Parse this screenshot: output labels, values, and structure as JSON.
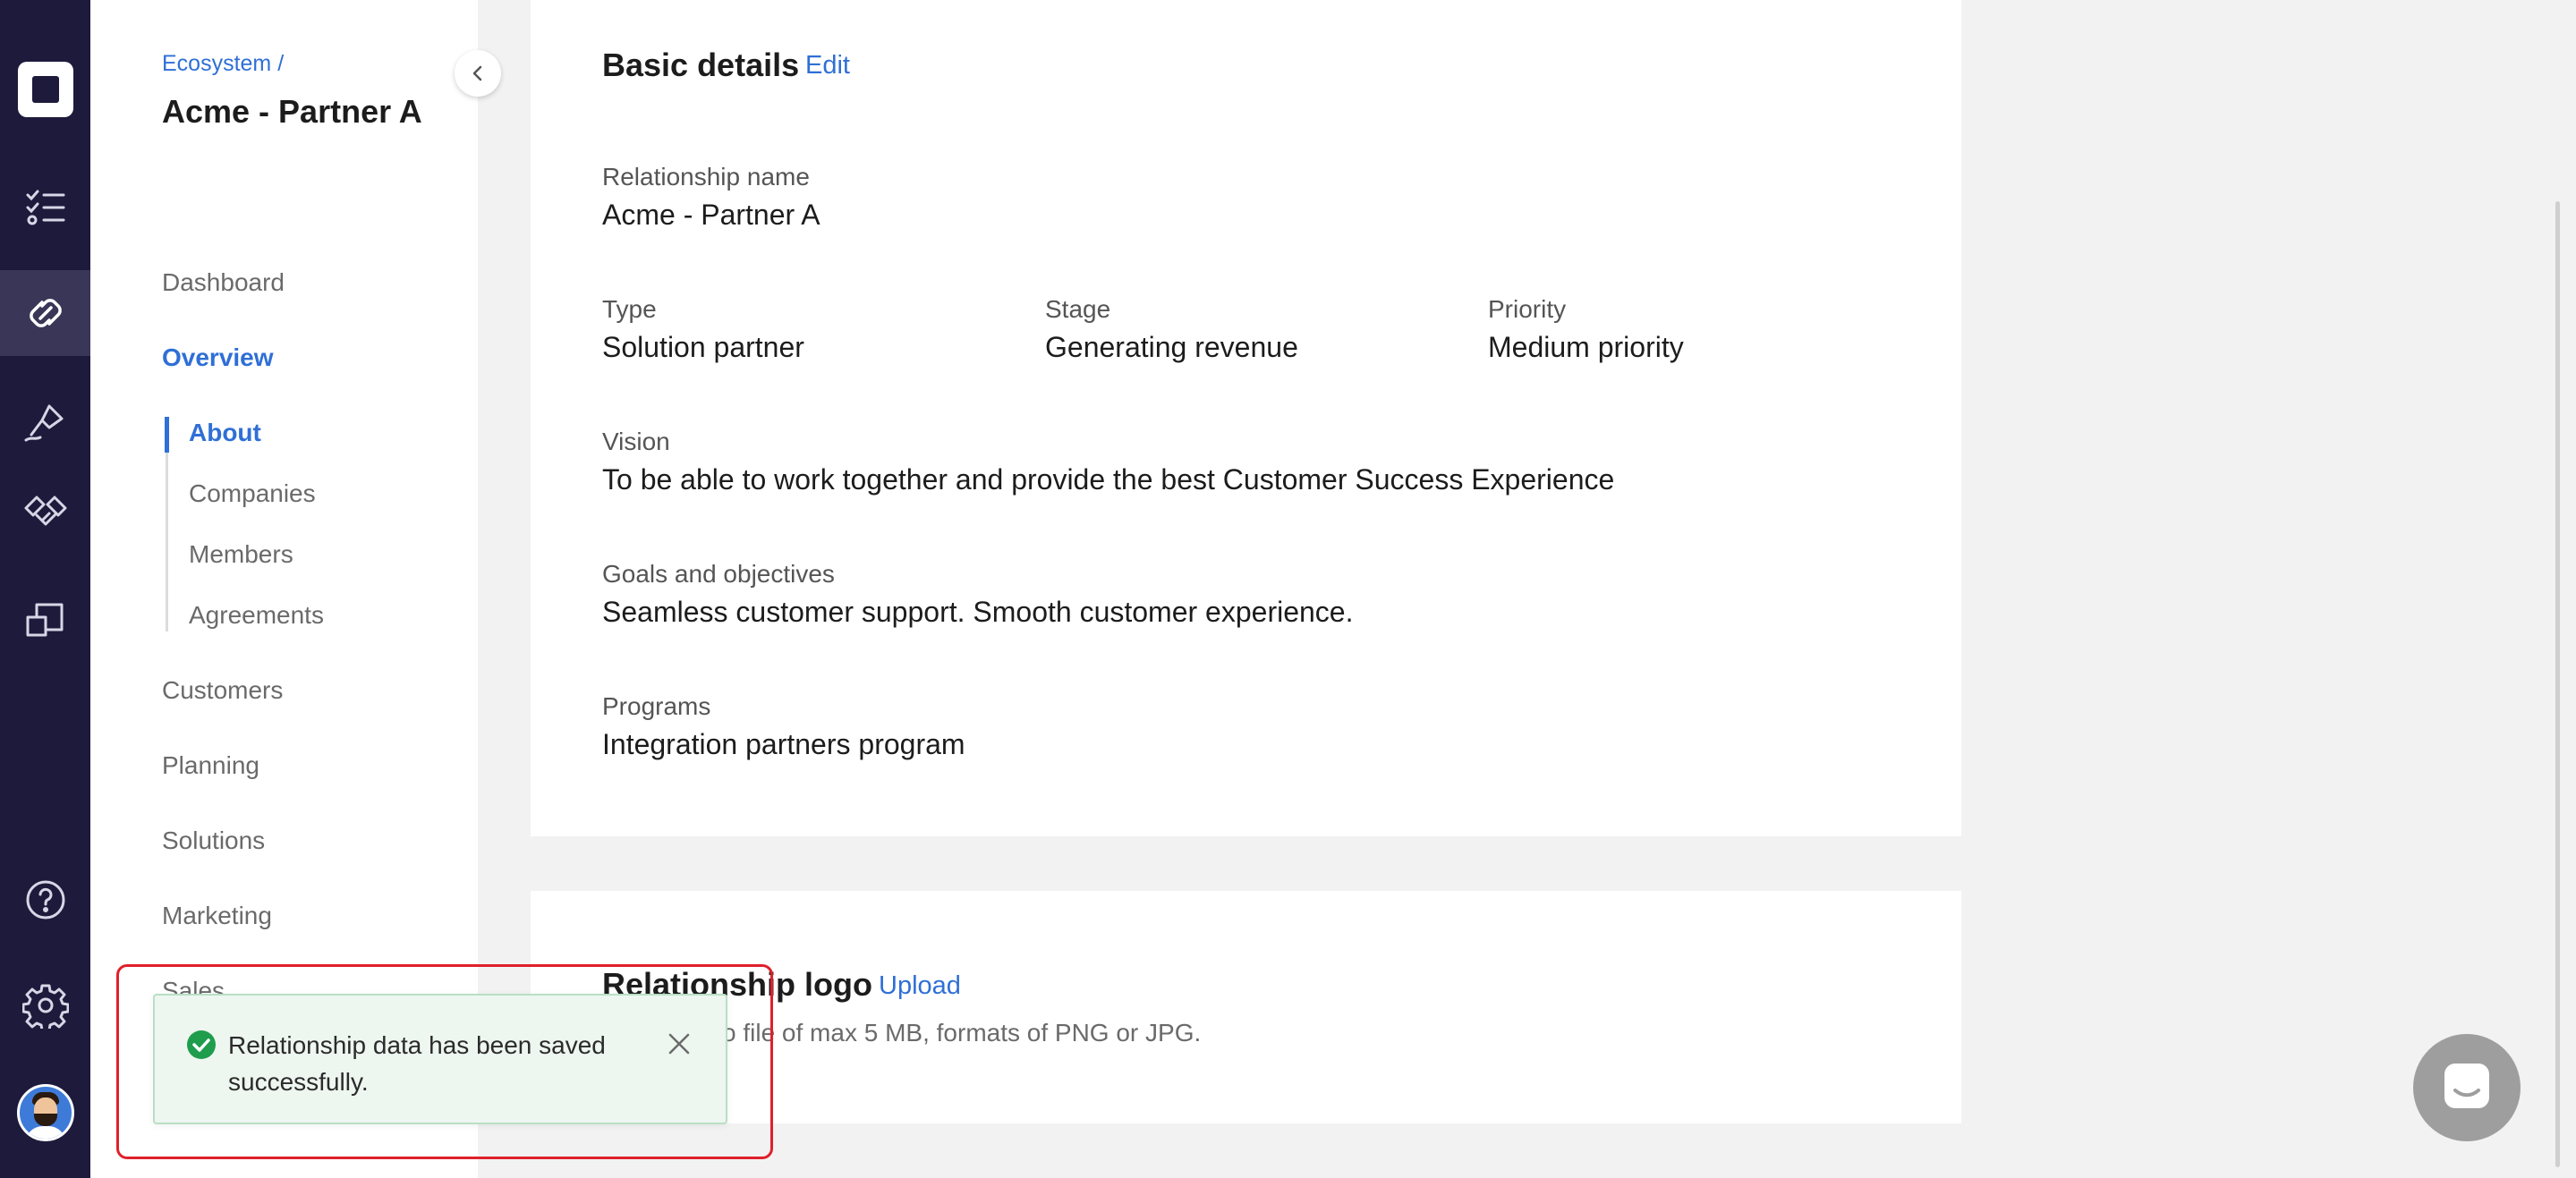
{
  "sidebar_rail": {
    "items": [
      {
        "icon": "app-logo"
      },
      {
        "icon": "checklist-icon"
      },
      {
        "icon": "link-icon",
        "active": true
      },
      {
        "icon": "pen-icon"
      },
      {
        "icon": "handshake-icon"
      },
      {
        "icon": "resize-icon"
      },
      {
        "icon": "help-icon"
      },
      {
        "icon": "gear-icon"
      },
      {
        "icon": "user-avatar"
      }
    ]
  },
  "sidenav": {
    "breadcrumb": "Ecosystem /",
    "title": "Acme - Partner A",
    "items": {
      "dashboard": "Dashboard",
      "overview": "Overview",
      "customers": "Customers",
      "planning": "Planning",
      "solutions": "Solutions",
      "marketing": "Marketing",
      "sales": "Sales"
    },
    "sub_items": {
      "about": "About",
      "companies": "Companies",
      "members": "Members",
      "agreements": "Agreements"
    }
  },
  "basic_details": {
    "title": "Basic details",
    "edit_label": "Edit",
    "relationship_name_label": "Relationship name",
    "relationship_name": "Acme - Partner A",
    "type_label": "Type",
    "type": "Solution partner",
    "stage_label": "Stage",
    "stage": "Generating revenue",
    "priority_label": "Priority",
    "priority": "Medium priority",
    "vision_label": "Vision",
    "vision": "To be able to work together and provide the best Customer Success Experience",
    "goals_label": "Goals and objectives",
    "goals": "Seamless customer support. Smooth customer experience.",
    "programs_label": "Programs",
    "programs": "Integration partners program"
  },
  "relationship_logo": {
    "title": "Relationship logo",
    "upload_label": "Upload",
    "helper": "o file of max 5 MB, formats of PNG or JPG."
  },
  "toast": {
    "message": "Relationship data has been saved successfully.",
    "status_color": "#1f9d4c"
  },
  "colors": {
    "accent": "#2f6fd6",
    "rail_bg": "#1e1a3c",
    "highlight": "#e0202a"
  }
}
